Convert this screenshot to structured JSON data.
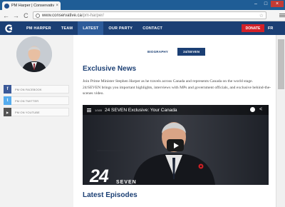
{
  "browser": {
    "tab_title": "PM Harper | Conservative...",
    "tab_close": "×",
    "url_domain": "www.conservative.ca",
    "url_path": "/pm-harper/",
    "back": "←",
    "forward": "→",
    "reload": "C",
    "star": "☆",
    "win_min": "–",
    "win_max": "□",
    "win_close": "×"
  },
  "nav": {
    "items": [
      "PM HARPER",
      "TEAM",
      "LATEST",
      "OUR PARTY",
      "CONTACT"
    ],
    "active_index": 2,
    "donate_label": "DONATE",
    "language_label": "FR"
  },
  "sidebar": {
    "social": [
      {
        "icon": "facebook-icon",
        "glyph": "f",
        "label": "PM ON FACEBOOK",
        "color": "#3b5998"
      },
      {
        "icon": "twitter-icon",
        "glyph": "t",
        "label": "PM ON TWITTER",
        "color": "#55acee"
      },
      {
        "icon": "youtube-icon",
        "glyph": "▶",
        "label": "PM ON YOUTUBE",
        "color": "#555555"
      }
    ]
  },
  "main": {
    "subtabs": [
      "BIOGRAPHY",
      "24/SEVEN"
    ],
    "active_subtab_index": 1,
    "heading": "Exclusive News",
    "intro": "Join Prime Minister Stephen Harper as he travels across Canada and represents Canada on the world stage. 24/SEVEN brings you important highlights, interviews with MPs and government officials, and exclusive behind-the-scenes video.",
    "video": {
      "counter": "1/165",
      "title": "24 SEVEN Exclusive: Your Canada",
      "watermark": "24",
      "watermark_sub": "SEVEN"
    },
    "latest_heading": "Latest Episodes"
  },
  "colors": {
    "nav_bg": "#1b3f74",
    "accent_red": "#d32027",
    "heading_blue": "#1b3f74"
  }
}
